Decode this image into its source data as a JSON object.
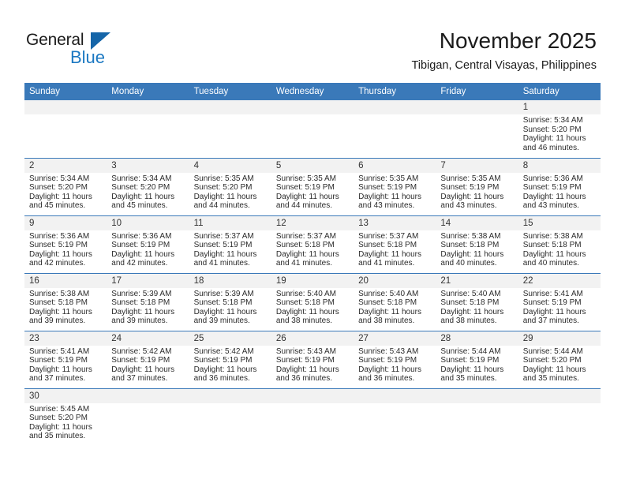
{
  "brand": {
    "name_top": "General",
    "name_bottom": "Blue",
    "triangle_color": "#1565a8",
    "blue_color": "#1b78c2"
  },
  "header": {
    "month_title": "November 2025",
    "location": "Tibigan, Central Visayas, Philippines"
  },
  "theme": {
    "header_band": "#3a79b9",
    "daynum_strip": "#f2f2f2",
    "cell_text": "#2b2b2b",
    "grid_line": "#3a79b9"
  },
  "weekday_headers": [
    "Sunday",
    "Monday",
    "Tuesday",
    "Wednesday",
    "Thursday",
    "Friday",
    "Saturday"
  ],
  "labels": {
    "sunrise_prefix": "Sunrise: ",
    "sunset_prefix": "Sunset: ",
    "daylight_prefix": "Daylight: "
  },
  "weeks": [
    [
      {
        "day": "",
        "empty": true
      },
      {
        "day": "",
        "empty": true
      },
      {
        "day": "",
        "empty": true
      },
      {
        "day": "",
        "empty": true
      },
      {
        "day": "",
        "empty": true
      },
      {
        "day": "",
        "empty": true
      },
      {
        "day": "1",
        "sunrise": "Sunrise: 5:34 AM",
        "sunset": "Sunset: 5:20 PM",
        "daylight_l1": "Daylight: 11 hours",
        "daylight_l2": "and 46 minutes."
      }
    ],
    [
      {
        "day": "2",
        "sunrise": "Sunrise: 5:34 AM",
        "sunset": "Sunset: 5:20 PM",
        "daylight_l1": "Daylight: 11 hours",
        "daylight_l2": "and 45 minutes."
      },
      {
        "day": "3",
        "sunrise": "Sunrise: 5:34 AM",
        "sunset": "Sunset: 5:20 PM",
        "daylight_l1": "Daylight: 11 hours",
        "daylight_l2": "and 45 minutes."
      },
      {
        "day": "4",
        "sunrise": "Sunrise: 5:35 AM",
        "sunset": "Sunset: 5:20 PM",
        "daylight_l1": "Daylight: 11 hours",
        "daylight_l2": "and 44 minutes."
      },
      {
        "day": "5",
        "sunrise": "Sunrise: 5:35 AM",
        "sunset": "Sunset: 5:19 PM",
        "daylight_l1": "Daylight: 11 hours",
        "daylight_l2": "and 44 minutes."
      },
      {
        "day": "6",
        "sunrise": "Sunrise: 5:35 AM",
        "sunset": "Sunset: 5:19 PM",
        "daylight_l1": "Daylight: 11 hours",
        "daylight_l2": "and 43 minutes."
      },
      {
        "day": "7",
        "sunrise": "Sunrise: 5:35 AM",
        "sunset": "Sunset: 5:19 PM",
        "daylight_l1": "Daylight: 11 hours",
        "daylight_l2": "and 43 minutes."
      },
      {
        "day": "8",
        "sunrise": "Sunrise: 5:36 AM",
        "sunset": "Sunset: 5:19 PM",
        "daylight_l1": "Daylight: 11 hours",
        "daylight_l2": "and 43 minutes."
      }
    ],
    [
      {
        "day": "9",
        "sunrise": "Sunrise: 5:36 AM",
        "sunset": "Sunset: 5:19 PM",
        "daylight_l1": "Daylight: 11 hours",
        "daylight_l2": "and 42 minutes."
      },
      {
        "day": "10",
        "sunrise": "Sunrise: 5:36 AM",
        "sunset": "Sunset: 5:19 PM",
        "daylight_l1": "Daylight: 11 hours",
        "daylight_l2": "and 42 minutes."
      },
      {
        "day": "11",
        "sunrise": "Sunrise: 5:37 AM",
        "sunset": "Sunset: 5:19 PM",
        "daylight_l1": "Daylight: 11 hours",
        "daylight_l2": "and 41 minutes."
      },
      {
        "day": "12",
        "sunrise": "Sunrise: 5:37 AM",
        "sunset": "Sunset: 5:18 PM",
        "daylight_l1": "Daylight: 11 hours",
        "daylight_l2": "and 41 minutes."
      },
      {
        "day": "13",
        "sunrise": "Sunrise: 5:37 AM",
        "sunset": "Sunset: 5:18 PM",
        "daylight_l1": "Daylight: 11 hours",
        "daylight_l2": "and 41 minutes."
      },
      {
        "day": "14",
        "sunrise": "Sunrise: 5:38 AM",
        "sunset": "Sunset: 5:18 PM",
        "daylight_l1": "Daylight: 11 hours",
        "daylight_l2": "and 40 minutes."
      },
      {
        "day": "15",
        "sunrise": "Sunrise: 5:38 AM",
        "sunset": "Sunset: 5:18 PM",
        "daylight_l1": "Daylight: 11 hours",
        "daylight_l2": "and 40 minutes."
      }
    ],
    [
      {
        "day": "16",
        "sunrise": "Sunrise: 5:38 AM",
        "sunset": "Sunset: 5:18 PM",
        "daylight_l1": "Daylight: 11 hours",
        "daylight_l2": "and 39 minutes."
      },
      {
        "day": "17",
        "sunrise": "Sunrise: 5:39 AM",
        "sunset": "Sunset: 5:18 PM",
        "daylight_l1": "Daylight: 11 hours",
        "daylight_l2": "and 39 minutes."
      },
      {
        "day": "18",
        "sunrise": "Sunrise: 5:39 AM",
        "sunset": "Sunset: 5:18 PM",
        "daylight_l1": "Daylight: 11 hours",
        "daylight_l2": "and 39 minutes."
      },
      {
        "day": "19",
        "sunrise": "Sunrise: 5:40 AM",
        "sunset": "Sunset: 5:18 PM",
        "daylight_l1": "Daylight: 11 hours",
        "daylight_l2": "and 38 minutes."
      },
      {
        "day": "20",
        "sunrise": "Sunrise: 5:40 AM",
        "sunset": "Sunset: 5:18 PM",
        "daylight_l1": "Daylight: 11 hours",
        "daylight_l2": "and 38 minutes."
      },
      {
        "day": "21",
        "sunrise": "Sunrise: 5:40 AM",
        "sunset": "Sunset: 5:18 PM",
        "daylight_l1": "Daylight: 11 hours",
        "daylight_l2": "and 38 minutes."
      },
      {
        "day": "22",
        "sunrise": "Sunrise: 5:41 AM",
        "sunset": "Sunset: 5:19 PM",
        "daylight_l1": "Daylight: 11 hours",
        "daylight_l2": "and 37 minutes."
      }
    ],
    [
      {
        "day": "23",
        "sunrise": "Sunrise: 5:41 AM",
        "sunset": "Sunset: 5:19 PM",
        "daylight_l1": "Daylight: 11 hours",
        "daylight_l2": "and 37 minutes."
      },
      {
        "day": "24",
        "sunrise": "Sunrise: 5:42 AM",
        "sunset": "Sunset: 5:19 PM",
        "daylight_l1": "Daylight: 11 hours",
        "daylight_l2": "and 37 minutes."
      },
      {
        "day": "25",
        "sunrise": "Sunrise: 5:42 AM",
        "sunset": "Sunset: 5:19 PM",
        "daylight_l1": "Daylight: 11 hours",
        "daylight_l2": "and 36 minutes."
      },
      {
        "day": "26",
        "sunrise": "Sunrise: 5:43 AM",
        "sunset": "Sunset: 5:19 PM",
        "daylight_l1": "Daylight: 11 hours",
        "daylight_l2": "and 36 minutes."
      },
      {
        "day": "27",
        "sunrise": "Sunrise: 5:43 AM",
        "sunset": "Sunset: 5:19 PM",
        "daylight_l1": "Daylight: 11 hours",
        "daylight_l2": "and 36 minutes."
      },
      {
        "day": "28",
        "sunrise": "Sunrise: 5:44 AM",
        "sunset": "Sunset: 5:19 PM",
        "daylight_l1": "Daylight: 11 hours",
        "daylight_l2": "and 35 minutes."
      },
      {
        "day": "29",
        "sunrise": "Sunrise: 5:44 AM",
        "sunset": "Sunset: 5:20 PM",
        "daylight_l1": "Daylight: 11 hours",
        "daylight_l2": "and 35 minutes."
      }
    ],
    [
      {
        "day": "30",
        "sunrise": "Sunrise: 5:45 AM",
        "sunset": "Sunset: 5:20 PM",
        "daylight_l1": "Daylight: 11 hours",
        "daylight_l2": "and 35 minutes."
      },
      {
        "day": "",
        "empty": true
      },
      {
        "day": "",
        "empty": true
      },
      {
        "day": "",
        "empty": true
      },
      {
        "day": "",
        "empty": true
      },
      {
        "day": "",
        "empty": true
      },
      {
        "day": "",
        "empty": true
      }
    ]
  ]
}
